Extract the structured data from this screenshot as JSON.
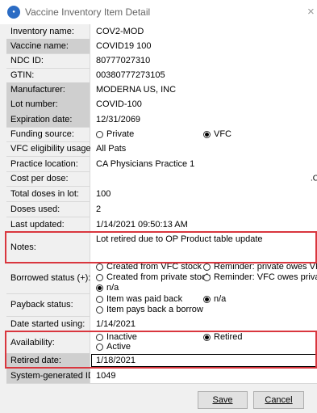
{
  "window": {
    "title": "Vaccine Inventory Item Detail",
    "icon": "app-logo-icon",
    "close": "×"
  },
  "fields": {
    "inventory_name": {
      "label": "Inventory name:",
      "value": "COV2-MOD"
    },
    "vaccine_name": {
      "label": "Vaccine name:",
      "value": "COVID19 100"
    },
    "ndc_id": {
      "label": "NDC ID:",
      "value": "80777027310"
    },
    "gtin": {
      "label": "GTIN:",
      "value": "00380777273105"
    },
    "manufacturer": {
      "label": "Manufacturer:",
      "value": "MODERNA US, INC"
    },
    "lot_number": {
      "label": "Lot number:",
      "value": "COVID-100"
    },
    "expiration_date": {
      "label": "Expiration date:",
      "value": "12/31/2069"
    },
    "funding_source": {
      "label": "Funding source:",
      "options": [
        "Private",
        "VFC"
      ],
      "selected": "VFC"
    },
    "vfc_usage": {
      "label": "VFC eligibility usage:",
      "value": "All Pats"
    },
    "practice_location": {
      "label": "Practice location:",
      "value": "CA Physicians Practice 1"
    },
    "cost_per_dose": {
      "label": "Cost per dose:",
      "value": ".C"
    },
    "total_doses": {
      "label": "Total doses in lot:",
      "value": "100"
    },
    "doses_used": {
      "label": "Doses used:",
      "value": "2"
    },
    "last_updated": {
      "label": "Last updated:",
      "value": "1/14/2021 09:50:13 AM"
    },
    "notes": {
      "label": "Notes:",
      "value": "Lot retired due to OP Product table update"
    },
    "borrowed_status": {
      "label": "Borrowed status (+):",
      "options": [
        "Created from VFC stock",
        "Created from private stock",
        "n/a",
        "Reminder: private owes VFC",
        "Reminder: VFC owes private"
      ],
      "selected": "n/a"
    },
    "payback_status": {
      "label": "Payback status:",
      "options": [
        "Item was paid back",
        "Item pays back a borrow",
        "n/a"
      ],
      "selected": "n/a"
    },
    "date_started": {
      "label": "Date started using:",
      "value": "1/14/2021"
    },
    "availability": {
      "label": "Availability:",
      "options": [
        "Inactive",
        "Active",
        "Retired"
      ],
      "selected": "Retired"
    },
    "retired_date": {
      "label": "Retired date:",
      "value": "1/18/2021"
    },
    "system_id": {
      "label": "System-generated ID:",
      "value": "1049"
    }
  },
  "buttons": {
    "save": "Save",
    "cancel": "Cancel"
  },
  "colors": {
    "highlight": "#d9363e",
    "label_shade": "#cfcfcf"
  }
}
